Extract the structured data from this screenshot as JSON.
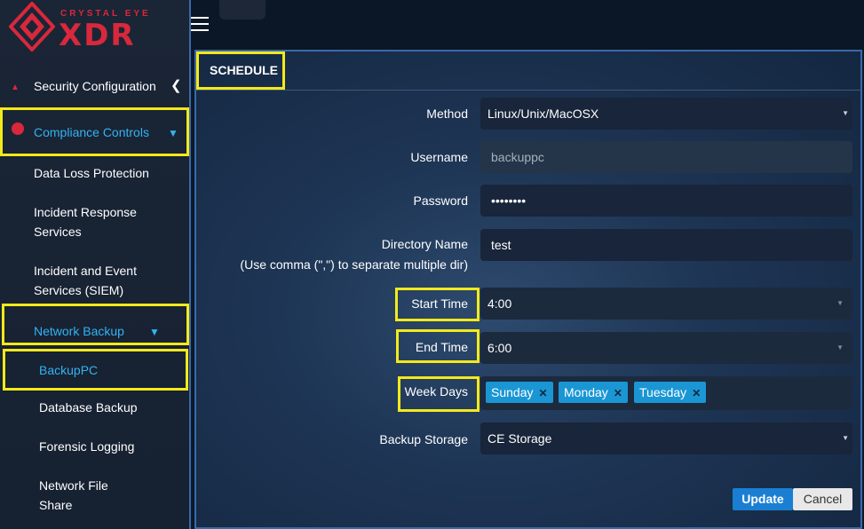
{
  "brand": {
    "top": "CRYSTAL EYE",
    "main": "XDR"
  },
  "sidebar": {
    "items": [
      {
        "label": "Security Configuration"
      },
      {
        "label": "Compliance Controls"
      },
      {
        "label": "Data Loss Protection"
      },
      {
        "label": "Incident Response",
        "label2": "Services"
      },
      {
        "label": "Incident and Event",
        "label2": "Services (SIEM)"
      },
      {
        "label": "Network Backup"
      },
      {
        "label": "BackupPC"
      },
      {
        "label": "Database Backup"
      },
      {
        "label": "Forensic Logging"
      },
      {
        "label": "Network File",
        "label2": "Share"
      }
    ]
  },
  "panel": {
    "title": "SCHEDULE",
    "fields": {
      "method": {
        "label": "Method",
        "value": "Linux/Unix/MacOSX"
      },
      "username": {
        "label": "Username",
        "placeholder": "backuppc"
      },
      "password": {
        "label": "Password",
        "value": "••••••••"
      },
      "directory": {
        "label": "Directory Name",
        "label2": "(Use comma (\",\") to separate multiple dir)",
        "value": "test"
      },
      "start_time": {
        "label": "Start Time",
        "value": "4:00"
      },
      "end_time": {
        "label": "End Time",
        "value": "6:00"
      },
      "week_days": {
        "label": "Week Days",
        "tags": [
          "Sunday",
          "Monday",
          "Tuesday"
        ]
      },
      "backup_storage": {
        "label": "Backup Storage",
        "value": "CE Storage"
      }
    },
    "buttons": {
      "update": "Update",
      "cancel": "Cancel"
    }
  },
  "colors": {
    "highlight": "#f3e91a",
    "accent": "#33b3f0",
    "brand": "#d8283c",
    "tag": "#1a96d4",
    "button": "#1a7fd2"
  },
  "icons": [
    "crystal-eye-logo",
    "hamburger-menu-icon",
    "triangle-icon",
    "circle-icon",
    "chevron-left-icon",
    "chevron-down-icon",
    "caret-down-icon",
    "close-icon"
  ]
}
